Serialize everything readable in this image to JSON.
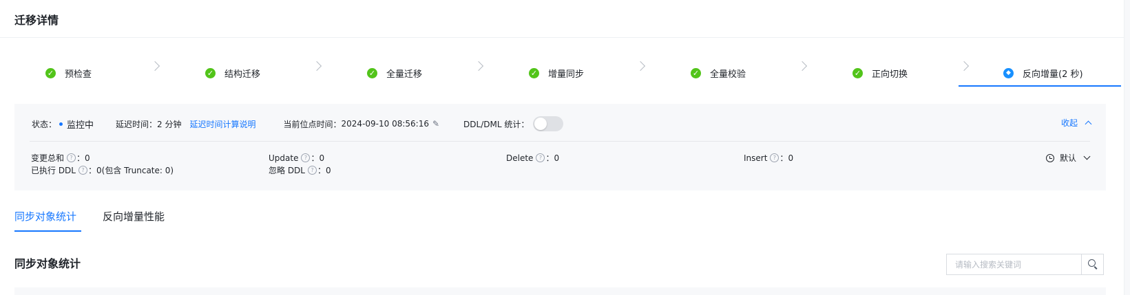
{
  "header": {
    "title": "迁移详情"
  },
  "steps": [
    {
      "label": "预检查",
      "status": "done"
    },
    {
      "label": "结构迁移",
      "status": "done"
    },
    {
      "label": "全量迁移",
      "status": "done"
    },
    {
      "label": "增量同步",
      "status": "done"
    },
    {
      "label": "全量校验",
      "status": "done"
    },
    {
      "label": "正向切换",
      "status": "done"
    },
    {
      "label": "反向增量(2 秒)",
      "status": "active"
    }
  ],
  "monitor": {
    "status_label": "状态：",
    "status_value": "监控中",
    "delay_label": "延迟时间：",
    "delay_value": "2 分钟",
    "delay_help_link": "延迟时间计算说明",
    "position_label": "当前位点时间：",
    "position_value": "2024-09-10 08:56:16",
    "ddl_dml_label": "DDL/DML 统计：",
    "ddl_dml_enabled": false,
    "collapse_label": "收起",
    "stats": {
      "total_changes": {
        "label": "变更总和",
        "value": "0"
      },
      "update": {
        "label": "Update",
        "value": "0"
      },
      "delete": {
        "label": "Delete",
        "value": "0"
      },
      "insert": {
        "label": "Insert",
        "value": "0"
      },
      "executed_ddl": {
        "label": "已执行 DDL",
        "value": "0(包含 Truncate: 0)"
      },
      "ignored_ddl": {
        "label": "忽略 DDL",
        "value": "0"
      }
    },
    "time_range": "默认"
  },
  "tabs": [
    {
      "label": "同步对象统计",
      "active": true
    },
    {
      "label": "反向增量性能",
      "active": false
    }
  ],
  "section": {
    "title": "同步对象统计"
  },
  "search": {
    "placeholder": "请输入搜索关键词",
    "value": ""
  },
  "colors": {
    "accent": "#1677ff",
    "success": "#52c41a",
    "panel_bg": "#f7f8fa"
  },
  "icons": {
    "done": "check-circle-icon",
    "active": "sync-icon",
    "search": "search-icon",
    "clock": "clock-icon",
    "edit": "edit-icon"
  }
}
